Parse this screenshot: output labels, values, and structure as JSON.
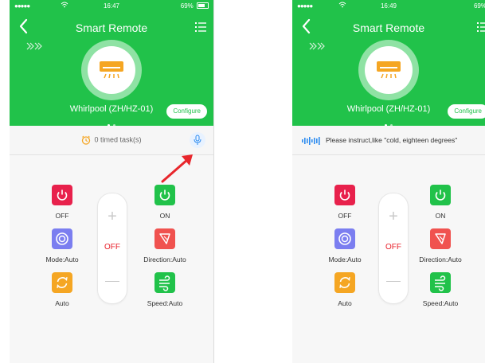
{
  "colors": {
    "brand_green": "#21c24a",
    "power_red": "#e8214c",
    "mode_purple": "#7b7ef0",
    "auto_orange": "#f5a623",
    "direction_red": "#f0524f",
    "state_red": "#e8212b",
    "mic_blue": "#2d8cf0"
  },
  "left": {
    "status": {
      "time": "16:47",
      "battery": "69%"
    },
    "nav": {
      "title": "Smart Remote"
    },
    "device": {
      "name": "Whirlpool  (ZH/HZ-01)",
      "configure_label": "Configure"
    },
    "timed_tasks": "0 timed task(s)",
    "controls": {
      "off": "OFF",
      "on": "ON",
      "mode": "Mode:Auto",
      "direction": "Direction:Auto",
      "auto": "Auto",
      "speed": "Speed:Auto",
      "power_state": "OFF"
    }
  },
  "right": {
    "status": {
      "time": "16:49",
      "battery": "69%"
    },
    "nav": {
      "title": "Smart Remote"
    },
    "device": {
      "name": "Whirlpool  (ZH/HZ-01)",
      "configure_label": "Configure"
    },
    "voice_prompt": "Please instruct,like \"cold, eighteen degrees\"",
    "controls": {
      "off": "OFF",
      "on": "ON",
      "mode": "Mode:Auto",
      "direction": "Direction:Auto",
      "auto": "Auto",
      "speed": "Speed:Auto",
      "power_state": "OFF"
    }
  },
  "icons": {
    "back": "chevron-left-icon",
    "menu": "list-menu-icon",
    "device": "air-conditioner-icon",
    "clock": "alarm-clock-icon",
    "mic": "microphone-icon",
    "voice": "sound-wave-icon",
    "power": "power-icon",
    "mode": "mode-icon",
    "direction": "swing-direction-icon",
    "auto": "auto-cycle-icon",
    "speed": "wind-speed-icon"
  }
}
